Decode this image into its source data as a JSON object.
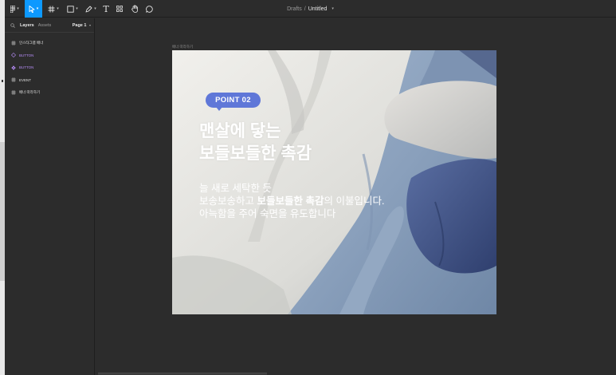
{
  "app": {
    "breadcrumb_root": "Drafts",
    "breadcrumb_sep": "/",
    "file_name": "Untitled",
    "accent_color": "#0d99ff"
  },
  "toolbar": {
    "tools": [
      {
        "name": "main-menu",
        "icon": "figma-logo-icon"
      },
      {
        "name": "move-tool",
        "icon": "pointer-icon",
        "active": true
      },
      {
        "name": "frame-tool",
        "icon": "frame-hash-icon"
      },
      {
        "name": "shape-tool",
        "icon": "rectangle-icon"
      },
      {
        "name": "pen-tool",
        "icon": "pen-icon"
      },
      {
        "name": "text-tool",
        "icon": "text-icon"
      },
      {
        "name": "resources-tool",
        "icon": "resources-icon"
      },
      {
        "name": "hand-tool",
        "icon": "hand-icon"
      },
      {
        "name": "comment-tool",
        "icon": "comment-icon"
      }
    ],
    "text_glyph": "T"
  },
  "panel": {
    "tab_layers": "Layers",
    "tab_assets": "Assets",
    "page": "Page 1",
    "layers": [
      {
        "label": "인스타그램 배너",
        "kind": "frame",
        "icon": "frame-hash-icon"
      },
      {
        "label": "BUTTON",
        "kind": "component-set",
        "icon": "component-diamond-icon"
      },
      {
        "label": "BUTTON",
        "kind": "component",
        "icon": "component-icon"
      },
      {
        "label": "EVENT",
        "kind": "frame",
        "icon": "frame-hash-icon"
      },
      {
        "label": "배너 따라하기",
        "kind": "frame",
        "icon": "frame-hash-icon"
      }
    ]
  },
  "canvas": {
    "frame_label": "배너 따라하기",
    "banner": {
      "badge": "POINT 02",
      "badge_color": "#5f77d8",
      "headline_line1": "맨살에 닿는",
      "headline_line2": "보들보들한 촉감",
      "body_line1": "늘 새로 세탁한 듯",
      "body_line2_pre": "보송보송하고 ",
      "body_line2_bold": "보들보들한 촉감",
      "body_line2_post": "의 이불입니다.",
      "body_line3": "아늑함을 주어 숙면을 유도합니다"
    }
  }
}
